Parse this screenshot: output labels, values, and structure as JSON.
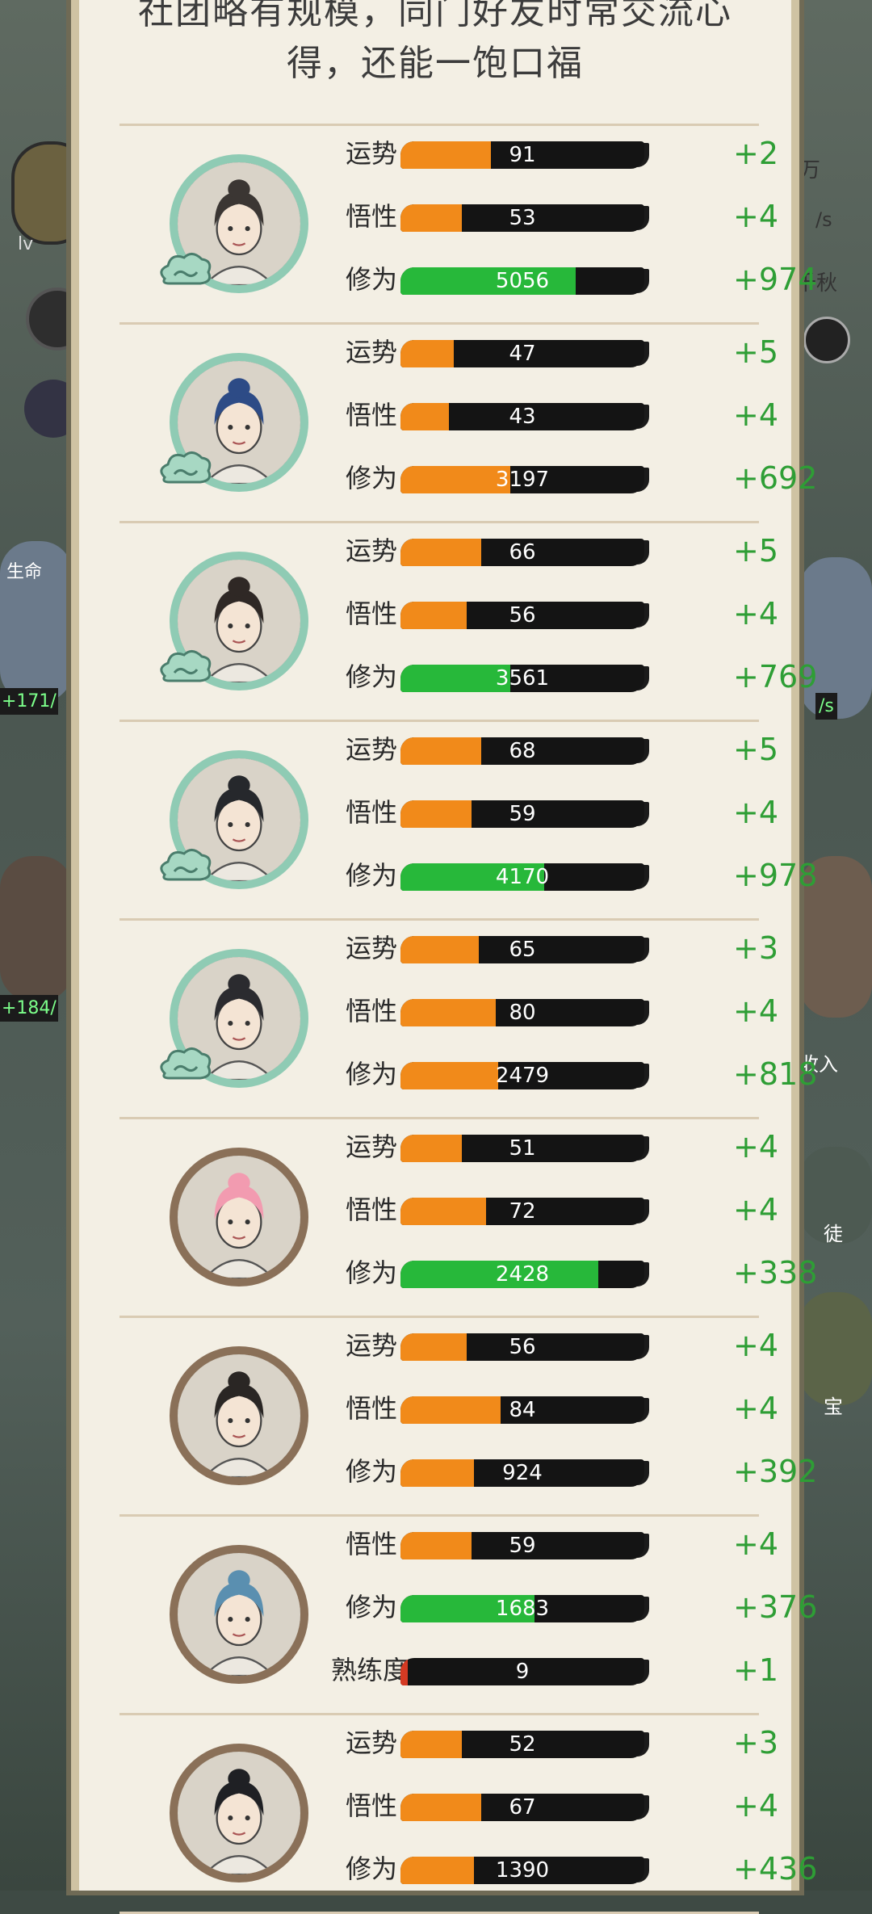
{
  "header": {
    "line1": "社团略有规模，同门好友时常交流心",
    "line2": "得，还能一饱口福"
  },
  "background": {
    "lv": "lv",
    "life": "生命",
    "left_num1": "+171/",
    "left_num2": "+184/",
    "right_wan": "万",
    "right_s1": "/s",
    "right_qiu": "千秋",
    "right_s2": "/s",
    "right_ru": "收入",
    "right_jian": "徒",
    "right_bao": "宝"
  },
  "colors": {
    "bar_orange": "#f18a1a",
    "bar_green": "#27b83a",
    "bar_red": "#d43a23",
    "delta_green": "#2e9e35",
    "panel_bg": "#f3efe4"
  },
  "disciples": [
    {
      "frame": "jade",
      "hair": "#3b3633",
      "stats": [
        {
          "label": "运势",
          "value": "91",
          "fill": 0.37,
          "color": "orange",
          "delta": "+2"
        },
        {
          "label": "悟性",
          "value": "53",
          "fill": 0.25,
          "color": "orange",
          "delta": "+4"
        },
        {
          "label": "修为",
          "value": "5056",
          "fill": 0.72,
          "color": "green",
          "delta": "+974"
        }
      ]
    },
    {
      "frame": "jade",
      "hair": "#2d4b86",
      "stats": [
        {
          "label": "运势",
          "value": "47",
          "fill": 0.22,
          "color": "orange",
          "delta": "+5"
        },
        {
          "label": "悟性",
          "value": "43",
          "fill": 0.2,
          "color": "orange",
          "delta": "+4"
        },
        {
          "label": "修为",
          "value": "3197",
          "fill": 0.45,
          "color": "orange",
          "delta": "+692"
        }
      ]
    },
    {
      "frame": "jade",
      "hair": "#2f2825",
      "stats": [
        {
          "label": "运势",
          "value": "66",
          "fill": 0.33,
          "color": "orange",
          "delta": "+5"
        },
        {
          "label": "悟性",
          "value": "56",
          "fill": 0.27,
          "color": "orange",
          "delta": "+4"
        },
        {
          "label": "修为",
          "value": "3561",
          "fill": 0.45,
          "color": "green",
          "delta": "+769"
        }
      ]
    },
    {
      "frame": "jade",
      "hair": "#26282c",
      "stats": [
        {
          "label": "运势",
          "value": "68",
          "fill": 0.33,
          "color": "orange",
          "delta": "+5"
        },
        {
          "label": "悟性",
          "value": "59",
          "fill": 0.29,
          "color": "orange",
          "delta": "+4"
        },
        {
          "label": "修为",
          "value": "4170",
          "fill": 0.59,
          "color": "green",
          "delta": "+978"
        }
      ]
    },
    {
      "frame": "jade",
      "hair": "#2b2b2f",
      "stats": [
        {
          "label": "运势",
          "value": "65",
          "fill": 0.32,
          "color": "orange",
          "delta": "+3"
        },
        {
          "label": "悟性",
          "value": "80",
          "fill": 0.39,
          "color": "orange",
          "delta": "+4"
        },
        {
          "label": "修为",
          "value": "2479",
          "fill": 0.4,
          "color": "orange",
          "delta": "+818"
        }
      ]
    },
    {
      "frame": "bronze",
      "hair": "#f29bb0",
      "stats": [
        {
          "label": "运势",
          "value": "51",
          "fill": 0.25,
          "color": "orange",
          "delta": "+4"
        },
        {
          "label": "悟性",
          "value": "72",
          "fill": 0.35,
          "color": "orange",
          "delta": "+4"
        },
        {
          "label": "修为",
          "value": "2428",
          "fill": 0.81,
          "color": "green",
          "delta": "+338"
        }
      ]
    },
    {
      "frame": "bronze",
      "hair": "#2a2624",
      "stats": [
        {
          "label": "运势",
          "value": "56",
          "fill": 0.27,
          "color": "orange",
          "delta": "+4"
        },
        {
          "label": "悟性",
          "value": "84",
          "fill": 0.41,
          "color": "orange",
          "delta": "+4"
        },
        {
          "label": "修为",
          "value": "924",
          "fill": 0.3,
          "color": "orange",
          "delta": "+392"
        }
      ]
    },
    {
      "frame": "bronze",
      "hair": "#5a8fb0",
      "stats": [
        {
          "label": "悟性",
          "value": "59",
          "fill": 0.29,
          "color": "orange",
          "delta": "+4"
        },
        {
          "label": "修为",
          "value": "1683",
          "fill": 0.55,
          "color": "green",
          "delta": "+376"
        },
        {
          "label": "熟练度",
          "value": "9",
          "fill": 0.03,
          "color": "red",
          "delta": "+1"
        }
      ]
    },
    {
      "frame": "bronze",
      "hair": "#1f2024",
      "stats": [
        {
          "label": "运势",
          "value": "52",
          "fill": 0.25,
          "color": "orange",
          "delta": "+3"
        },
        {
          "label": "悟性",
          "value": "67",
          "fill": 0.33,
          "color": "orange",
          "delta": "+4"
        },
        {
          "label": "修为",
          "value": "1390",
          "fill": 0.3,
          "color": "orange",
          "delta": "+436"
        }
      ]
    }
  ]
}
